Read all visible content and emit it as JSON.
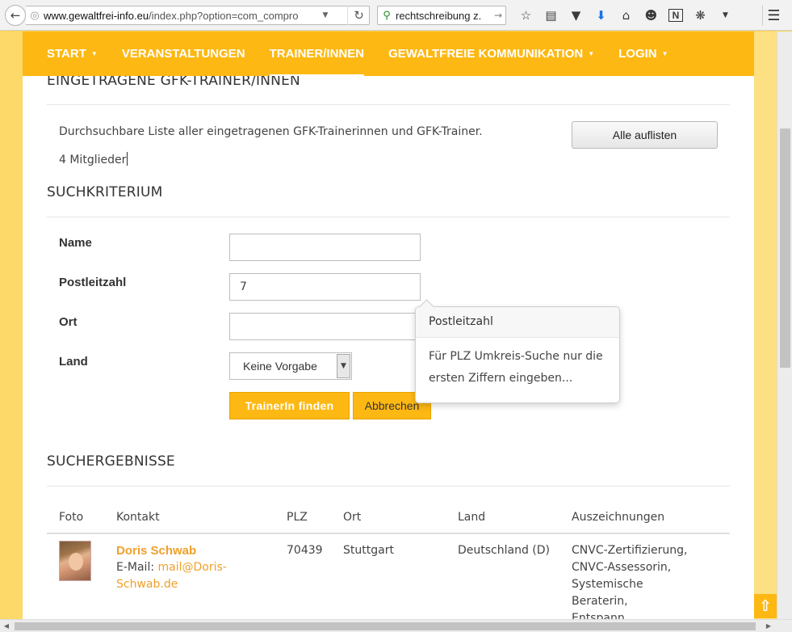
{
  "browser": {
    "url_host": "www.gewaltfrei-info.eu",
    "url_path": "/index.php?option=com_compro",
    "search_text": "rechtschreibung z."
  },
  "nav": {
    "items": [
      {
        "label": "START",
        "caret": "▼"
      },
      {
        "label": "VERANSTALTUNGEN",
        "caret": ""
      },
      {
        "label": "TRAINER/INNEN",
        "caret": ""
      },
      {
        "label": "GEWALTFREIE KOMMUNIKATION",
        "caret": "▼"
      },
      {
        "label": "LOGIN",
        "caret": "▼"
      }
    ]
  },
  "main": {
    "title": "EINGETRAGENE GFK-TRAINER/INNEN",
    "description": "Durchsuchbare Liste aller eingetragenen GFK-Trainerinnen und GFK-Trainer.",
    "members": "4 Mitglieder",
    "list_all_label": "Alle auflisten"
  },
  "search": {
    "title": "SUCHKRITERIUM",
    "name_label": "Name",
    "name_value": "",
    "plz_label": "Postleitzahl",
    "plz_value": "7",
    "ort_label": "Ort",
    "ort_value": "",
    "land_label": "Land",
    "land_value": "Keine Vorgabe",
    "find_label": "TrainerIn finden",
    "cancel_label": "Abbrechen"
  },
  "popover": {
    "title": "Postleitzahl",
    "body": "Für PLZ Umkreis-Suche nur die ersten Ziffern eingeben..."
  },
  "results": {
    "title": "SUCHERGEBNISSE",
    "headers": [
      "Foto",
      "Kontakt",
      "PLZ",
      "Ort",
      "Land",
      "Auszeichnungen"
    ],
    "rows": [
      {
        "name": "Doris Schwab",
        "email_prefix": "E-Mail: ",
        "email_part1": "mail@Doris-",
        "email_part2": "Schwab.de",
        "plz": "70439",
        "ort": "Stuttgart",
        "land": "Deutschland (D)",
        "awards": [
          "CNVC-Zertifizierung,",
          "CNVC-Assessorin,",
          "Systemische",
          "Beraterin,",
          "Entspann..."
        ]
      }
    ]
  },
  "colors": {
    "accent": "#fdb813",
    "link": "#f0a02a",
    "side": "#fad456"
  }
}
